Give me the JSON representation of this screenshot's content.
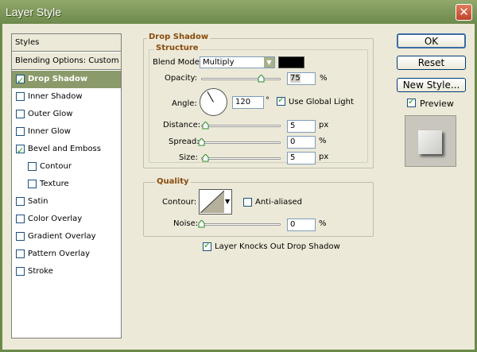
{
  "window": {
    "title": "Layer Style",
    "close_glyph": "✕"
  },
  "styles": {
    "header": "Styles",
    "blending": "Blending Options: Custom",
    "items": [
      {
        "label": "Drop Shadow",
        "checked": true,
        "selected": true,
        "indent": false
      },
      {
        "label": "Inner Shadow",
        "checked": false,
        "selected": false,
        "indent": false
      },
      {
        "label": "Outer Glow",
        "checked": false,
        "selected": false,
        "indent": false
      },
      {
        "label": "Inner Glow",
        "checked": false,
        "selected": false,
        "indent": false
      },
      {
        "label": "Bevel and Emboss",
        "checked": true,
        "selected": false,
        "indent": false
      },
      {
        "label": "Contour",
        "checked": false,
        "selected": false,
        "indent": true
      },
      {
        "label": "Texture",
        "checked": false,
        "selected": false,
        "indent": true
      },
      {
        "label": "Satin",
        "checked": false,
        "selected": false,
        "indent": false
      },
      {
        "label": "Color Overlay",
        "checked": false,
        "selected": false,
        "indent": false
      },
      {
        "label": "Gradient Overlay",
        "checked": false,
        "selected": false,
        "indent": false
      },
      {
        "label": "Pattern Overlay",
        "checked": false,
        "selected": false,
        "indent": false
      },
      {
        "label": "Stroke",
        "checked": false,
        "selected": false,
        "indent": false
      }
    ]
  },
  "drop_shadow": {
    "title": "Drop Shadow",
    "structure": "Structure",
    "blend_mode_label": "Blend Mode:",
    "blend_mode_value": "Multiply",
    "shadow_color": "#000000",
    "opacity_label": "Opacity:",
    "opacity_value": "75",
    "opacity_unit": "%",
    "opacity_level": 0.75,
    "angle_label": "Angle:",
    "angle_value": "120",
    "angle_unit": "°",
    "use_global_light": "Use Global Light",
    "use_global_light_checked": true,
    "distance_label": "Distance:",
    "distance_value": "5",
    "distance_unit": "px",
    "spread_label": "Spread:",
    "spread_value": "0",
    "spread_unit": "%",
    "size_label": "Size:",
    "size_value": "5",
    "size_unit": "px"
  },
  "quality": {
    "title": "Quality",
    "contour_label": "Contour:",
    "anti_aliased": "Anti-aliased",
    "anti_aliased_checked": false,
    "noise_label": "Noise:",
    "noise_value": "0",
    "noise_unit": "%",
    "knockout": "Layer Knocks Out Drop Shadow",
    "knockout_checked": true
  },
  "buttons": {
    "ok": "OK",
    "reset": "Reset",
    "new_style": "New Style...",
    "preview": "Preview",
    "preview_checked": true
  },
  "colors": {
    "title_bar": "#7d9659",
    "selected_item": "#8b9a6a",
    "group_title": "#8a4b0e"
  }
}
